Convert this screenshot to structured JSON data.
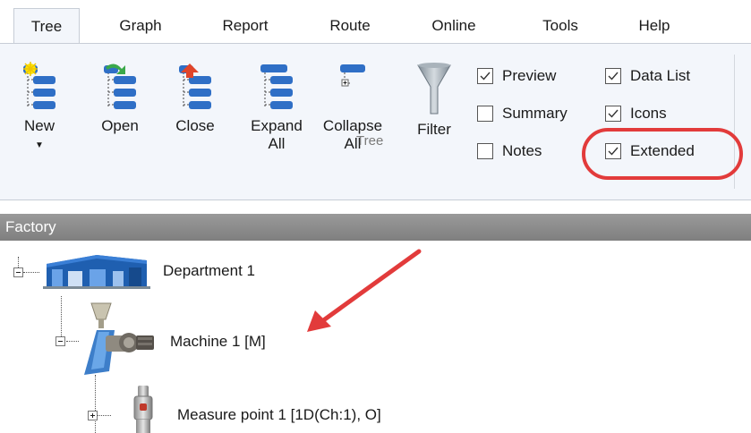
{
  "tabs": [
    {
      "label": "Tree",
      "active": true
    },
    {
      "label": "Graph"
    },
    {
      "label": "Report"
    },
    {
      "label": "Route"
    },
    {
      "label": "Online"
    },
    {
      "label": "Tools"
    },
    {
      "label": "Help"
    }
  ],
  "ribbon": {
    "buttons": {
      "new": {
        "line1": "New",
        "icon": "new-tree-icon"
      },
      "open": {
        "line1": "Open",
        "icon": "open-tree-icon"
      },
      "close": {
        "line1": "Close",
        "icon": "close-tree-icon"
      },
      "expand": {
        "line1": "Expand",
        "line2": "All",
        "icon": "expand-all-icon"
      },
      "collapse": {
        "line1": "Collapse",
        "line2": "All",
        "icon": "collapse-all-icon"
      },
      "filter": {
        "line1": "Filter",
        "icon": "funnel-icon"
      }
    },
    "checkboxes": {
      "preview": {
        "label": "Preview",
        "checked": true
      },
      "summary": {
        "label": "Summary",
        "checked": false
      },
      "notes": {
        "label": "Notes",
        "checked": false
      },
      "data_list": {
        "label": "Data List",
        "checked": true
      },
      "icons": {
        "label": "Icons",
        "checked": true
      },
      "extended": {
        "label": "Extended",
        "checked": true
      }
    },
    "group_label": "Tree"
  },
  "tree": {
    "header": "Factory",
    "nodes": [
      {
        "label": "Department 1",
        "icon": "building-icon",
        "expander": "minus"
      },
      {
        "label": "Machine 1 [M]",
        "icon": "machine-icon",
        "expander": "minus"
      },
      {
        "label": "Measure point 1 [1D(Ch:1), O]",
        "icon": "sensor-icon",
        "expander": "plus"
      }
    ]
  },
  "annotations": {
    "highlight_color": "#e23b3b",
    "arrow_color": "#e23b3b"
  },
  "colors": {
    "ribbon_bg": "#f3f6fb",
    "tree_header_bg": "#8a8a8a",
    "tree_icon_blue": "#2f6fc6"
  }
}
